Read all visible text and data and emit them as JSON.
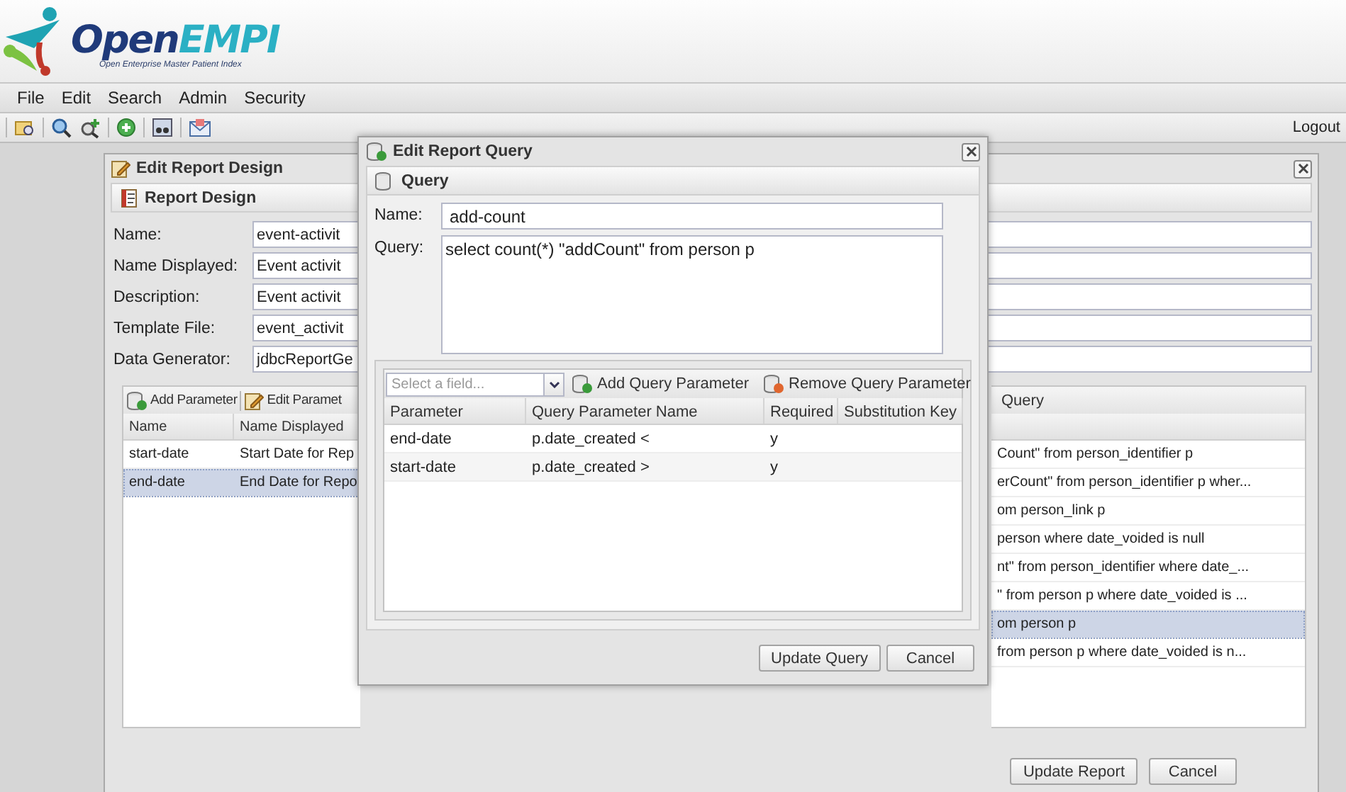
{
  "logo": {
    "parts": [
      "Open",
      "EMPI"
    ],
    "subtitle": "Open Enterprise Master Patient Index"
  },
  "menu": [
    "File",
    "Edit",
    "Search",
    "Admin",
    "Security"
  ],
  "toolbar": {
    "logout": "Logout"
  },
  "design_window": {
    "title": "Edit Report Design",
    "panel_title": "Report Design",
    "fields": [
      {
        "label": "Name:",
        "value": "event-activit"
      },
      {
        "label": "Name Displayed:",
        "value": "Event activit"
      },
      {
        "label": "Description:",
        "value": "Event activit"
      },
      {
        "label": "Template File:",
        "value": "event_activit"
      },
      {
        "label": "Data Generator:",
        "value": "jdbcReportGe"
      }
    ],
    "parameters": {
      "actions": [
        {
          "kind": "add",
          "label": "Add Parameter"
        },
        {
          "kind": "edit",
          "label": "Edit Paramet"
        }
      ],
      "columns": [
        "Name",
        "Name Displayed"
      ],
      "rows": [
        {
          "cells": [
            "start-date",
            "Start Date for Rep"
          ],
          "selected": false
        },
        {
          "cells": [
            "end-date",
            "End Date for Repo"
          ],
          "selected": true
        }
      ]
    },
    "queries": {
      "column": "Query",
      "rows": [
        {
          "text": "Count\" from person_identifier p",
          "selected": false
        },
        {
          "text": "erCount\" from person_identifier p wher...",
          "selected": false
        },
        {
          "text": "om person_link p",
          "selected": false
        },
        {
          "text": "person where date_voided is null",
          "selected": false
        },
        {
          "text": "nt\" from person_identifier where date_...",
          "selected": false
        },
        {
          "text": "\" from person p where date_voided is ...",
          "selected": false
        },
        {
          "text": "om person p",
          "selected": true
        },
        {
          "text": "from person p where date_voided is n...",
          "selected": false
        }
      ]
    },
    "buttons": [
      "Update Report",
      "Cancel"
    ]
  },
  "query_dialog": {
    "title": "Edit Report Query",
    "panel_title": "Query",
    "name_label": "Name:",
    "name_value": "add-count",
    "query_label": "Query:",
    "query_value": "select count(*) \"addCount\" from person p",
    "select_placeholder": "Select a field...",
    "actions": [
      {
        "kind": "add",
        "label": "Add Query Parameter"
      },
      {
        "kind": "remove",
        "label": "Remove Query Parameter"
      }
    ],
    "columns": [
      "Parameter",
      "Query Parameter Name",
      "Required",
      "Substitution Key"
    ],
    "rows": [
      {
        "cells": [
          "end-date",
          "p.date_created <",
          "y",
          ""
        ],
        "selected": false
      },
      {
        "cells": [
          "start-date",
          "p.date_created >",
          "y",
          ""
        ],
        "selected": false
      }
    ],
    "buttons": [
      "Update Query",
      "Cancel"
    ]
  }
}
